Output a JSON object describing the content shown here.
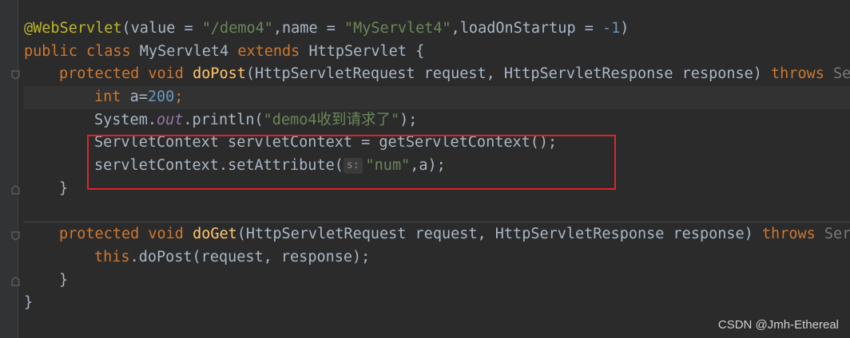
{
  "editor": {
    "lines": [
      {
        "parts": [
          "@WebServlet",
          "(value = ",
          "\"/demo4\"",
          ",name = ",
          "\"MyServlet4\"",
          ",loadOnStartup = ",
          "-1",
          ")"
        ]
      },
      {
        "parts": [
          "public class ",
          "MyServlet4 ",
          "extends ",
          "HttpServlet {"
        ]
      },
      {
        "parts": [
          "protected void ",
          "doPost",
          "(HttpServletRequest request, HttpServletResponse response) ",
          "throws ",
          "Ser"
        ]
      },
      {
        "parts": [
          "int ",
          "a=",
          "200",
          ";"
        ]
      },
      {
        "parts": [
          "System.",
          "out",
          ".println(",
          "\"demo4收到请求了\"",
          ");"
        ]
      },
      {
        "parts": [
          "ServletContext servletContext = getServletContext();"
        ]
      },
      {
        "parts": [
          "servletContext.setAttribute(",
          "s:",
          "\"num\"",
          ",a);"
        ]
      },
      {
        "parts": [
          "}"
        ]
      },
      {
        "parts": [
          ""
        ]
      },
      {
        "parts": [
          "protected void ",
          "doGet",
          "(HttpServletRequest request, HttpServletResponse response) ",
          "throws ",
          "Serv"
        ]
      },
      {
        "parts": [
          "this",
          ".doPost(request, response);"
        ]
      },
      {
        "parts": [
          "}"
        ]
      },
      {
        "parts": [
          "}"
        ]
      }
    ]
  },
  "colors": {
    "background": "#2b2b2b",
    "keyword": "#cc7832",
    "string": "#6a8759",
    "number": "#6897bb",
    "annotation": "#bbb529",
    "method": "#ffc66d",
    "highlight_box": "#d8262c"
  },
  "watermark": "CSDN @Jmh-Ethereal"
}
